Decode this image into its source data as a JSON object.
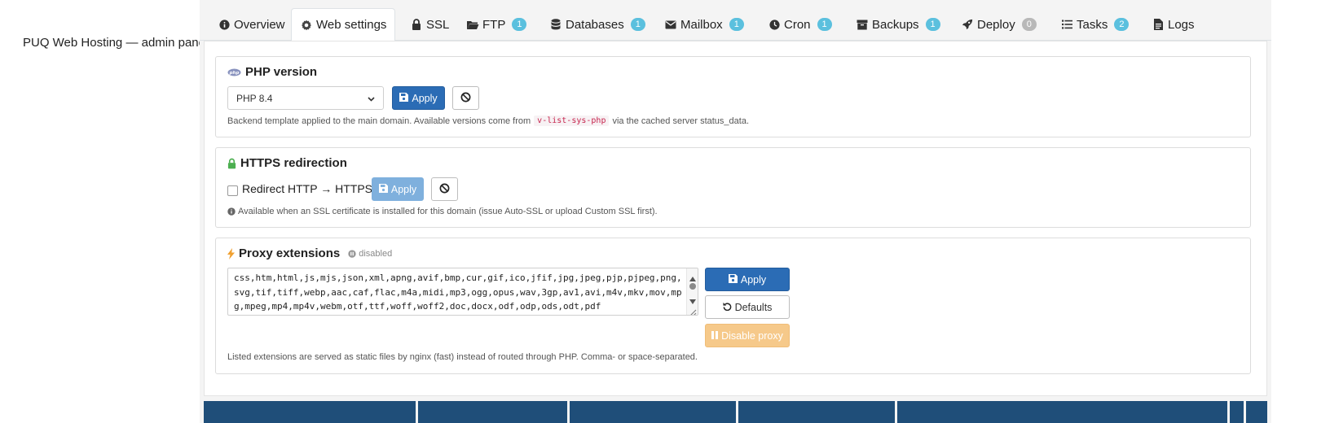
{
  "sidebar": {
    "title": "PUQ Web Hosting — admin panel"
  },
  "tabs": [
    {
      "label": "Overview",
      "icon": "info-circle-icon"
    },
    {
      "label": "Web settings",
      "icon": "gear-icon",
      "active": true
    },
    {
      "label": "SSL",
      "icon": "lock-icon"
    },
    {
      "label": "FTP",
      "icon": "folder-open-icon",
      "badge": "1"
    },
    {
      "label": "Databases",
      "icon": "database-icon",
      "badge": "1"
    },
    {
      "label": "Mailbox",
      "icon": "envelope-icon",
      "badge": "1"
    },
    {
      "label": "Cron",
      "icon": "clock-icon",
      "badge": "1"
    },
    {
      "label": "Backups",
      "icon": "archive-icon",
      "badge": "1"
    },
    {
      "label": "Deploy",
      "icon": "rocket-icon",
      "badge": "0"
    },
    {
      "label": "Tasks",
      "icon": "list-icon",
      "badge": "2"
    },
    {
      "label": "Logs",
      "icon": "file-icon"
    }
  ],
  "php": {
    "title": "PHP version",
    "selected": "PHP 8.4",
    "apply_label": "Apply",
    "help_before": "Backend template applied to the main domain. Available versions come from",
    "help_code": "v-list-sys-php",
    "help_after": "via the cached server status_data."
  },
  "https": {
    "title": "HTTPS redirection",
    "checkbox_label": "Redirect HTTP → HTTPS",
    "apply_label": "Apply",
    "help": "Available when an SSL certificate is installed for this domain (issue Auto-SSL or upload Custom SSL first)."
  },
  "proxy": {
    "title": "Proxy extensions",
    "status": "disabled",
    "extensions": "css,htm,html,js,mjs,json,xml,apng,avif,bmp,cur,gif,ico,jfif,jpg,jpeg,pjp,pjpeg,png,svg,tif,tiff,webp,aac,caf,flac,m4a,midi,mp3,ogg,opus,wav,3gp,av1,avi,m4v,mkv,mov,mpg,mpeg,mp4,mp4v,webm,otf,ttf,woff,woff2,doc,docx,odf,odp,ods,odt,pdf",
    "apply_label": "Apply",
    "defaults_label": "Defaults",
    "disable_label": "Disable proxy",
    "help": "Listed extensions are served as static files by nginx (fast) instead of routed through PHP. Comma- or space-separated."
  },
  "colors": {
    "primary": "#2b6cb5",
    "info_badge": "#5bc0de",
    "warning": "#f6c98a",
    "lock_green": "#4caf50",
    "bolt_orange": "#f0a030"
  }
}
